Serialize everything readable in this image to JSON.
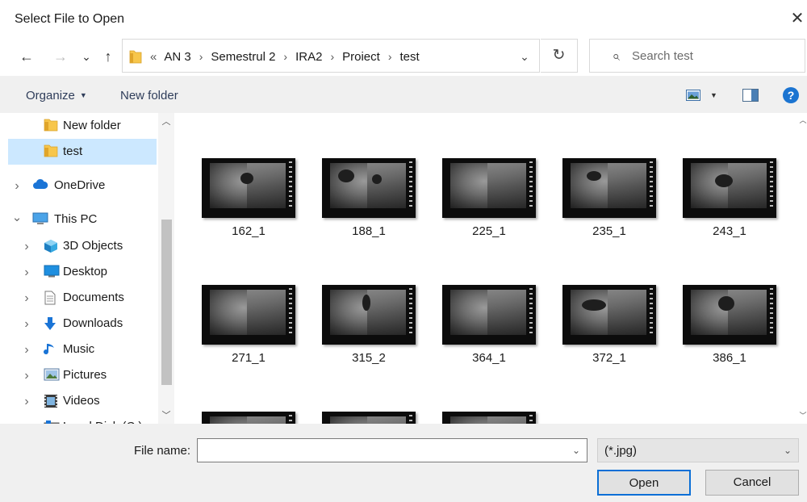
{
  "window": {
    "title": "Select File to Open",
    "close_glyph": "✕"
  },
  "nav_buttons": {
    "back": "←",
    "forward": "→",
    "recent": "⌄",
    "up": "↑"
  },
  "address": {
    "overflow": "«",
    "crumbs": [
      "AN 3",
      "Semestrul 2",
      "IRA2",
      "Proiect",
      "test"
    ],
    "separator": "›",
    "dropdown": "⌄",
    "refresh": "↻"
  },
  "search": {
    "placeholder": "Search test",
    "icon": "⌕"
  },
  "toolbar": {
    "organize": "Organize",
    "organize_caret": "▼",
    "new_folder": "New folder",
    "view_caret": "▼",
    "help": "?"
  },
  "nav_pane": {
    "items": [
      {
        "label": "New folder",
        "icon": "folder-icon",
        "indent": 2,
        "chevron": "",
        "selected": false
      },
      {
        "label": "test",
        "icon": "folder-icon",
        "indent": 2,
        "chevron": "",
        "selected": true
      },
      {
        "label": "OneDrive",
        "icon": "cloud-icon",
        "indent": 1,
        "chevron": ">",
        "selected": false
      },
      {
        "label": "This PC",
        "icon": "pc-icon",
        "indent": 1,
        "chevron": "v",
        "selected": false
      },
      {
        "label": "3D Objects",
        "icon": "cube-icon",
        "indent": 2,
        "chevron": ">",
        "selected": false
      },
      {
        "label": "Desktop",
        "icon": "desktop-icon",
        "indent": 2,
        "chevron": ">",
        "selected": false
      },
      {
        "label": "Documents",
        "icon": "document-icon",
        "indent": 2,
        "chevron": ">",
        "selected": false
      },
      {
        "label": "Downloads",
        "icon": "download-icon",
        "indent": 2,
        "chevron": ">",
        "selected": false
      },
      {
        "label": "Music",
        "icon": "music-icon",
        "indent": 2,
        "chevron": ">",
        "selected": false
      },
      {
        "label": "Pictures",
        "icon": "pictures-icon",
        "indent": 2,
        "chevron": ">",
        "selected": false
      },
      {
        "label": "Videos",
        "icon": "video-icon",
        "indent": 2,
        "chevron": ">",
        "selected": false
      },
      {
        "label": "Local Disk (C:)",
        "icon": "disk-icon",
        "indent": 2,
        "chevron": ">",
        "selected": false
      }
    ]
  },
  "files": [
    {
      "name": "162_1"
    },
    {
      "name": "188_1"
    },
    {
      "name": "225_1"
    },
    {
      "name": "235_1"
    },
    {
      "name": "243_1"
    },
    {
      "name": "271_1"
    },
    {
      "name": "315_2"
    },
    {
      "name": "364_1"
    },
    {
      "name": "372_1"
    },
    {
      "name": "386_1"
    },
    {
      "name": ""
    },
    {
      "name": ""
    },
    {
      "name": ""
    }
  ],
  "footer": {
    "file_name_label": "File name:",
    "file_name_value": "",
    "file_name_dropdown": "⌄",
    "filter_value": "(*.jpg)",
    "filter_dropdown": "⌄",
    "open_label": "Open",
    "cancel_label": "Cancel"
  },
  "colors": {
    "selected_bg": "#cce8ff",
    "accent": "#0a6fd6",
    "folder": "#f7c64b",
    "help": "#1b74d1"
  }
}
